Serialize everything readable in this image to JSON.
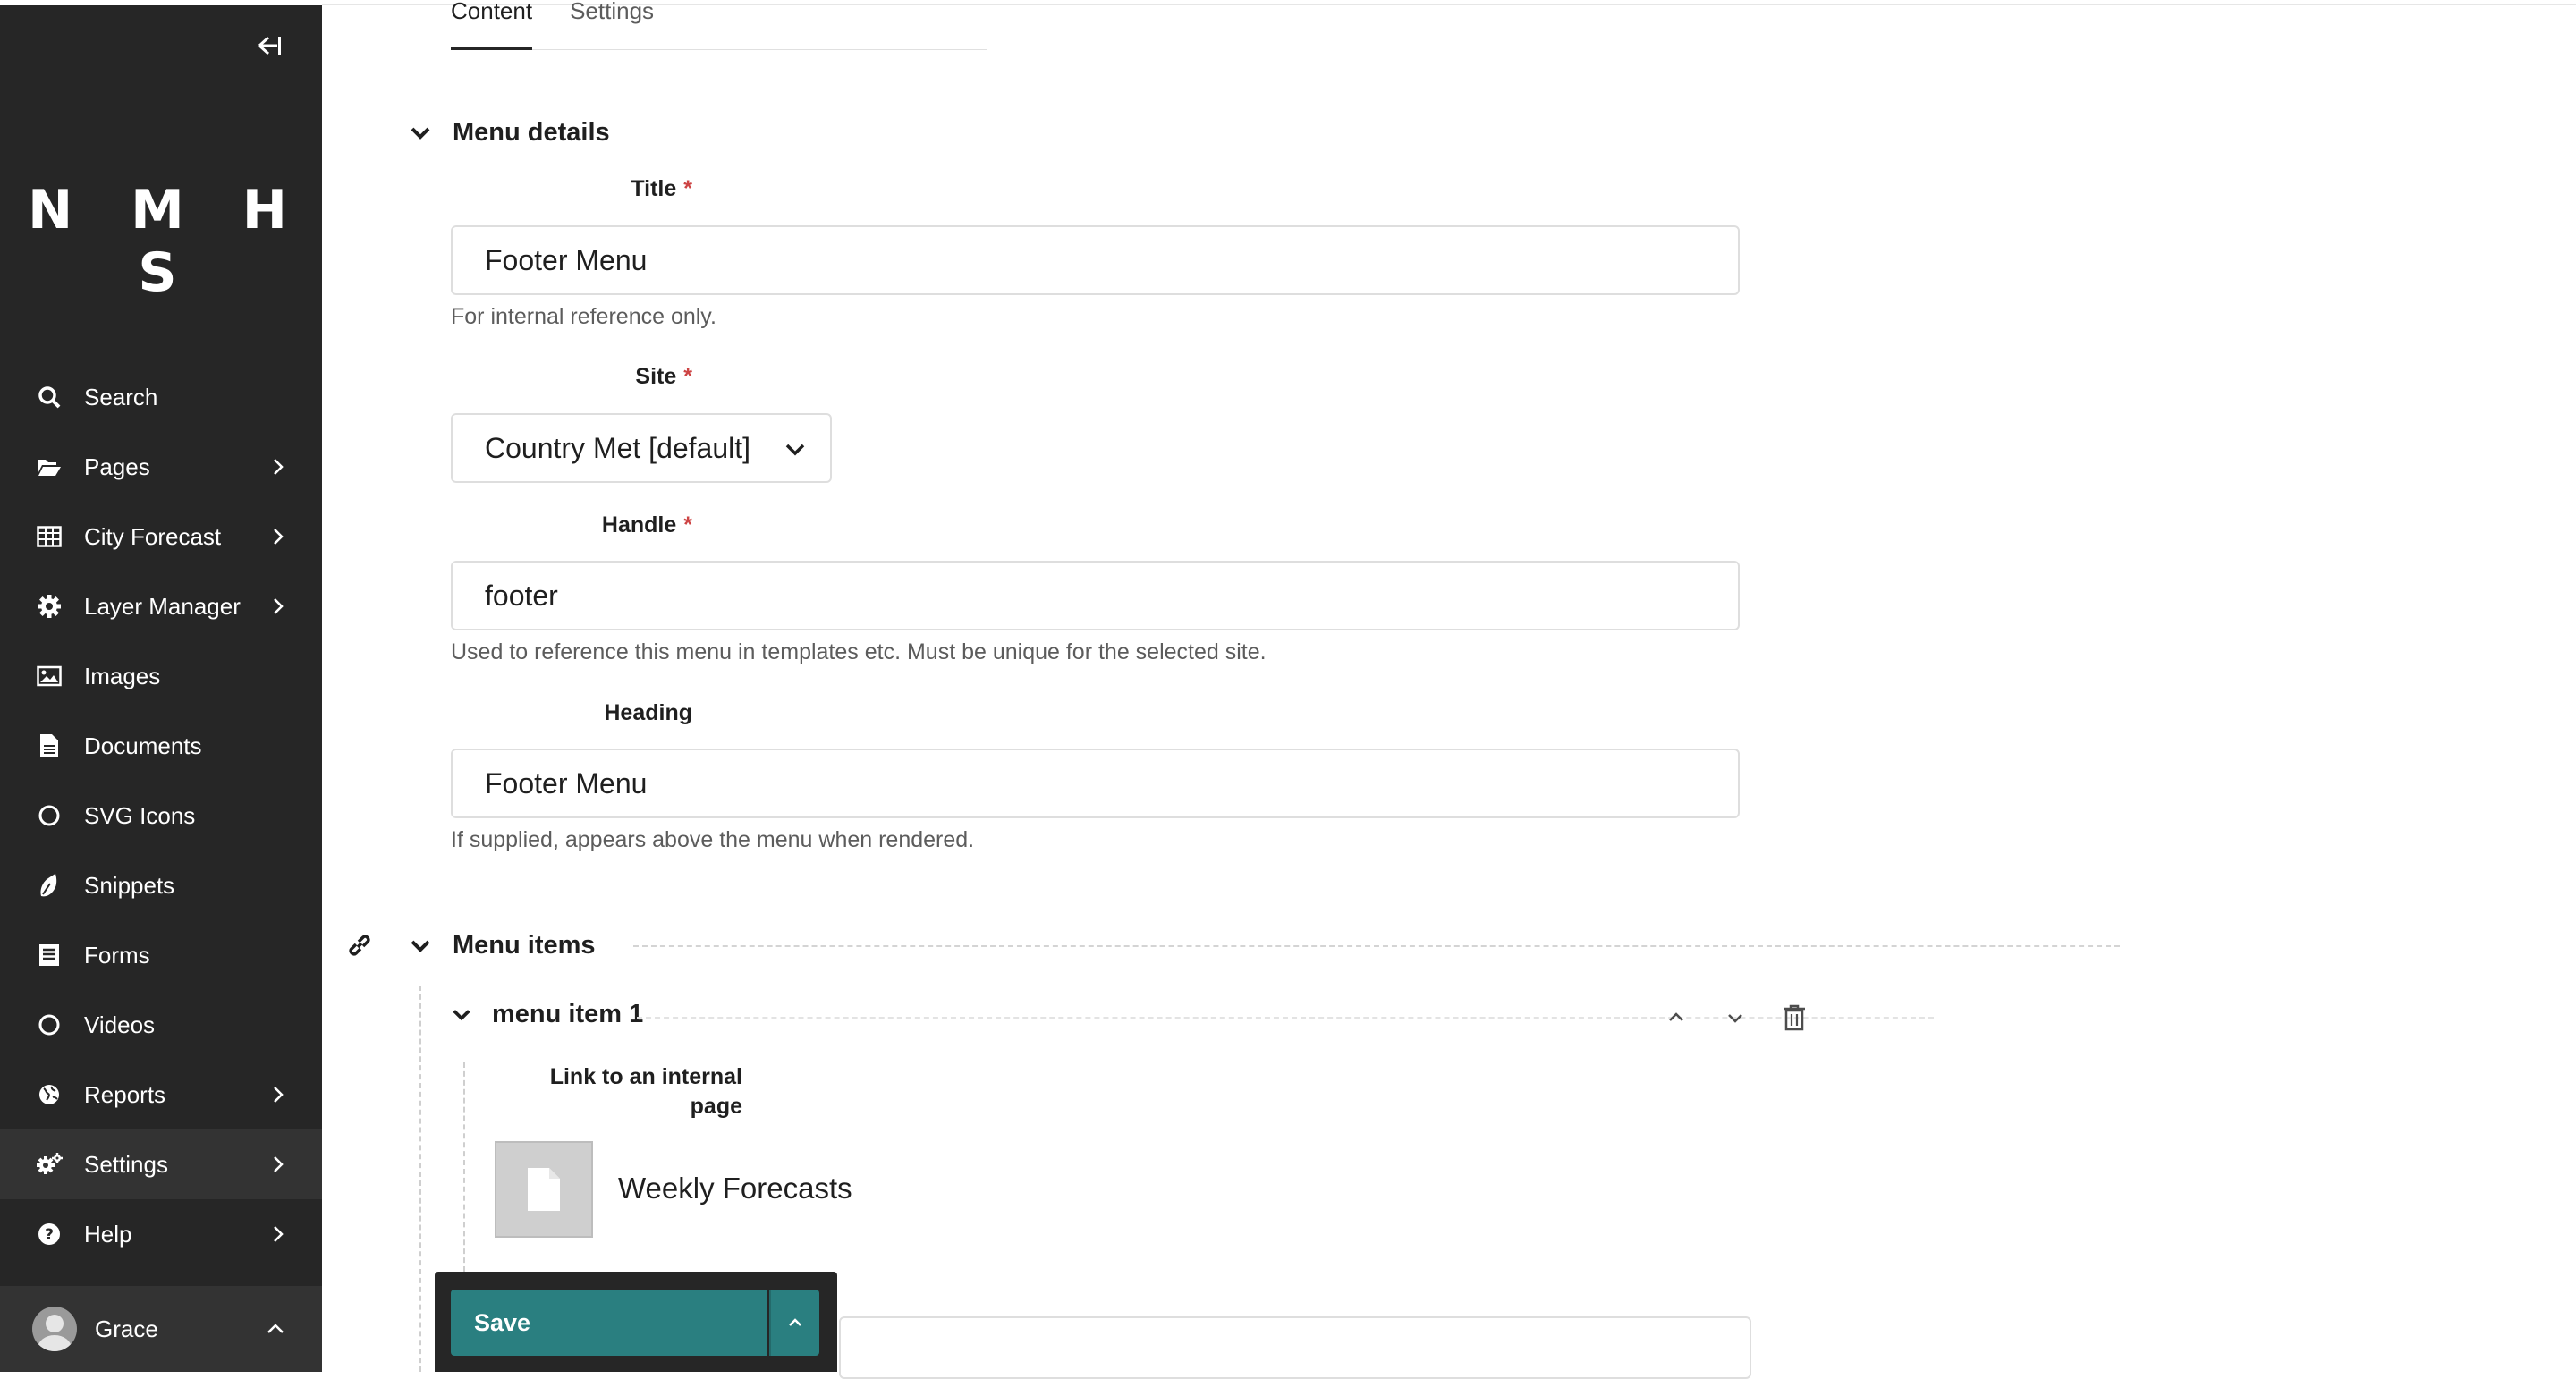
{
  "sidebar": {
    "logo": "N M H S",
    "items": [
      {
        "label": "Search",
        "icon": "search-icon",
        "has_children": false
      },
      {
        "label": "Pages",
        "icon": "folder-open-icon",
        "has_children": true
      },
      {
        "label": "City Forecast",
        "icon": "table-icon",
        "has_children": true
      },
      {
        "label": "Layer Manager",
        "icon": "cog-icon",
        "has_children": true
      },
      {
        "label": "Images",
        "icon": "image-icon",
        "has_children": false
      },
      {
        "label": "Documents",
        "icon": "document-icon",
        "has_children": false
      },
      {
        "label": "SVG Icons",
        "icon": "circle-icon",
        "has_children": false
      },
      {
        "label": "Snippets",
        "icon": "snippet-icon",
        "has_children": false
      },
      {
        "label": "Forms",
        "icon": "form-icon",
        "has_children": false
      },
      {
        "label": "Videos",
        "icon": "circle-icon",
        "has_children": false
      },
      {
        "label": "Reports",
        "icon": "globe-icon",
        "has_children": true
      },
      {
        "label": "Settings",
        "icon": "cogs-icon",
        "has_children": true
      },
      {
        "label": "Help",
        "icon": "help-icon",
        "has_children": true
      }
    ],
    "user": {
      "name": "Grace"
    }
  },
  "tabs": [
    "Content",
    "Settings"
  ],
  "menu_details": {
    "heading": "Menu details",
    "title_field": {
      "label": "Title",
      "required_mark": "*",
      "value": "Footer Menu",
      "help": "For internal reference only."
    },
    "site_field": {
      "label": "Site",
      "required_mark": "*",
      "value": "Country Met [default]"
    },
    "handle_field": {
      "label": "Handle",
      "required_mark": "*",
      "value": "footer",
      "help": "Used to reference this menu in templates etc. Must be unique for the selected site."
    },
    "heading_field": {
      "label": "Heading",
      "value": "Footer Menu",
      "help": "If supplied, appears above the menu when rendered."
    }
  },
  "menu_items": {
    "heading": "Menu items",
    "item": {
      "title": "menu item 1",
      "link_label": "Link to an internal page",
      "page_name": "Weekly Forecasts"
    }
  },
  "actions": {
    "save_label": "Save"
  },
  "colors": {
    "sidebar_bg": "#262626",
    "accent": "#2a7f80",
    "required": "#cd4444"
  }
}
